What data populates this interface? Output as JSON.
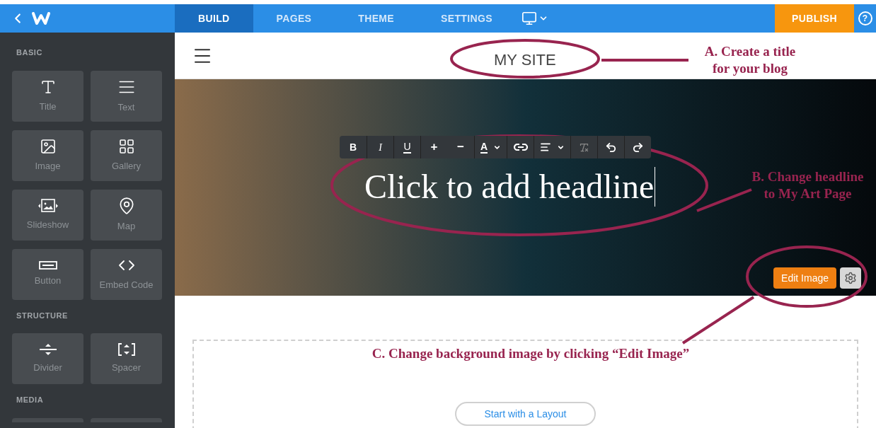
{
  "topbar": {
    "tabs": [
      {
        "label": "BUILD",
        "selected": true
      },
      {
        "label": "PAGES",
        "selected": false
      },
      {
        "label": "THEME",
        "selected": false
      },
      {
        "label": "SETTINGS",
        "selected": false
      }
    ],
    "publish": "PUBLISH",
    "help": "?"
  },
  "sidebar": {
    "sections": [
      {
        "title": "BASIC",
        "items": [
          {
            "kind": "title",
            "label": "Title"
          },
          {
            "kind": "text",
            "label": "Text"
          },
          {
            "kind": "image",
            "label": "Image"
          },
          {
            "kind": "gallery",
            "label": "Gallery"
          },
          {
            "kind": "slideshow",
            "label": "Slideshow"
          },
          {
            "kind": "map",
            "label": "Map"
          },
          {
            "kind": "button",
            "label": "Button"
          },
          {
            "kind": "embed",
            "label": "Embed Code"
          }
        ]
      },
      {
        "title": "STRUCTURE",
        "items": [
          {
            "kind": "divider",
            "label": "Divider"
          },
          {
            "kind": "spacer",
            "label": "Spacer"
          }
        ]
      },
      {
        "title": "MEDIA",
        "items": [
          {
            "kind": "partial"
          },
          {
            "kind": "partial"
          }
        ]
      }
    ]
  },
  "site": {
    "title": "MY SITE",
    "headline": "Click to add headline",
    "toolbar": [
      {
        "kind": "bold",
        "label": "B"
      },
      {
        "kind": "italic",
        "label": "I"
      },
      {
        "kind": "underline",
        "label": "U"
      },
      {
        "kind": "size",
        "label": "+"
      },
      {
        "kind": "size",
        "label": "−"
      },
      {
        "kind": "color",
        "label": "A",
        "dropdown": true
      },
      {
        "kind": "link"
      },
      {
        "kind": "align",
        "dropdown": true
      },
      {
        "kind": "clear"
      },
      {
        "kind": "undo"
      },
      {
        "kind": "redo"
      }
    ],
    "edit_image": "Edit Image",
    "layout_button": "Start with a Layout"
  },
  "annotations": [
    {
      "kind": "title",
      "lines": [
        "A.  Create a title",
        "for your blog"
      ]
    },
    {
      "kind": "headline",
      "lines": [
        "B.  Change headline",
        "to My Art Page"
      ]
    },
    {
      "kind": "background",
      "lines": [
        "C.  Change background image by clicking “Edit Image”"
      ]
    }
  ]
}
